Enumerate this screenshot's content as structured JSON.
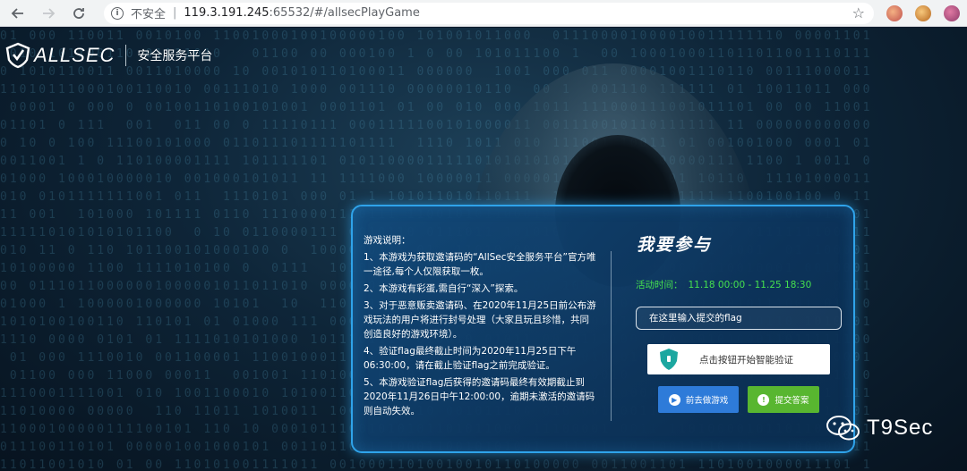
{
  "browser": {
    "back_icon": "arrow-left-icon",
    "forward_icon": "arrow-right-icon",
    "reload_icon": "reload-icon",
    "security_label": "不安全",
    "url_host": "119.3.191.245",
    "url_rest": ":65532/#/allsecPlayGame",
    "bookmark_icon": "star-icon"
  },
  "header": {
    "brand": "ALLSEC",
    "platform": "安全服务平台"
  },
  "rules": {
    "title": "游戏说明：",
    "items": [
      "1、本游戏为获取邀请码的“AllSec安全服务平台”官方唯一途径,每个人仅限获取一枚。",
      "2、本游戏有彩蛋,需自行“深入”探索。",
      "3、对于恶意贩卖邀请码、在2020年11月25日前公布游戏玩法的用户将进行封号处理（大家且玩且珍惜，共同创造良好的游戏环境）。",
      "4、验证flag最终截止时间为2020年11月25日下午06:30:00，请在截止验证flag之前完成验证。",
      "5、本游戏验证flag后获得的邀请码最终有效期截止到2020年11月26日中午12:00:00，逾期未激活的邀请码则自动失效。"
    ]
  },
  "join": {
    "title": "我要参与",
    "activity_label": "活动时间：",
    "activity_time": "11.18 00:00 - 11.25 18:30",
    "flag_placeholder": "在这里输入提交的flag",
    "captcha_text": "点击按钮开始智能验证",
    "play_button": "前去做游戏",
    "submit_button": "提交答案"
  },
  "watermark": "T9Sec",
  "colors": {
    "panel_border": "#2fa3ea",
    "activity_green": "#45e04f",
    "play_blue": "#2e7bd9",
    "submit_green": "#58b630"
  }
}
